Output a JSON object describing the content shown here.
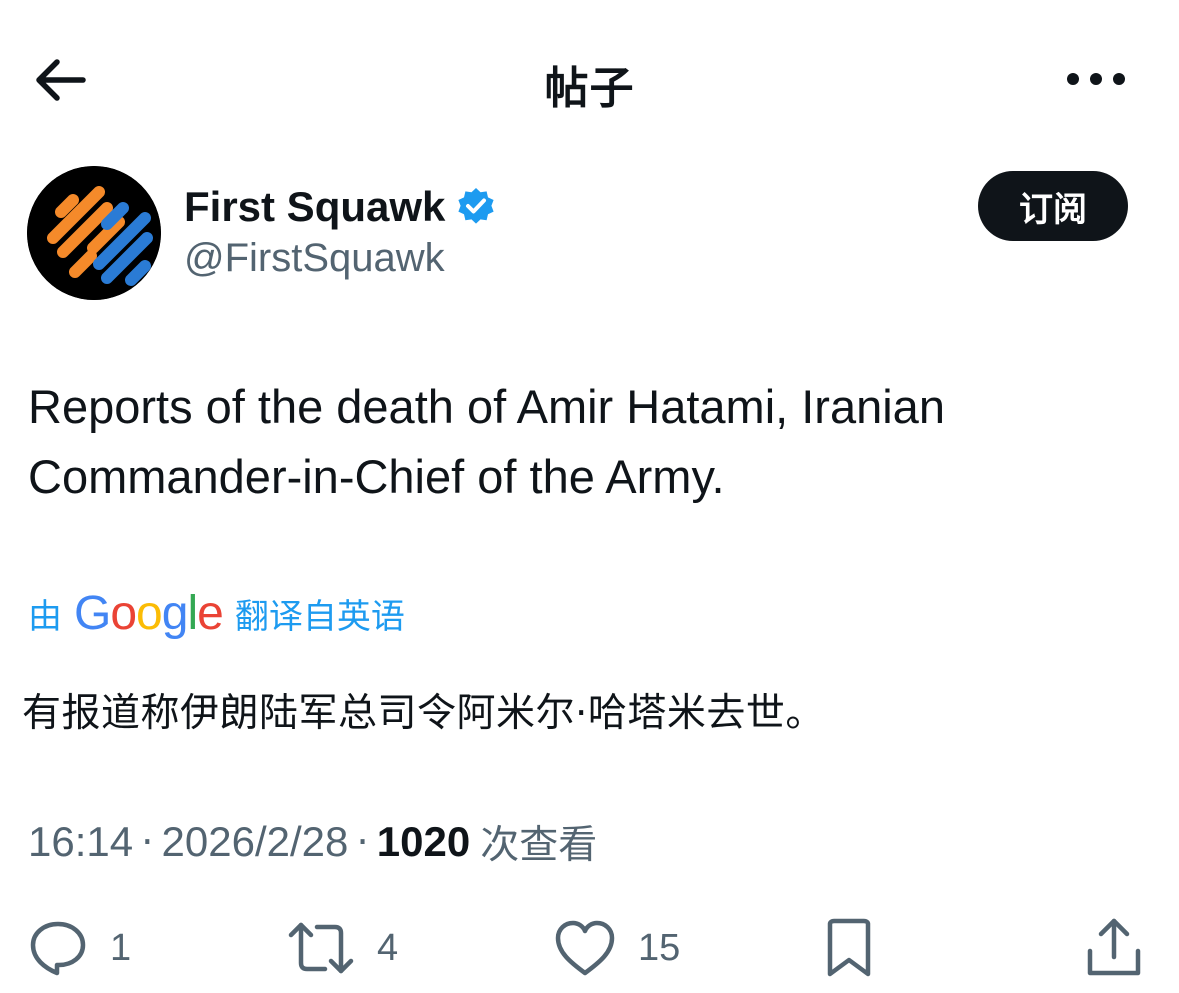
{
  "header": {
    "title": "帖子",
    "back_icon": "arrow-left-icon",
    "more_icon": "more-horizontal-icon"
  },
  "author": {
    "display_name": "First Squawk",
    "handle": "@FirstSquawk",
    "verified": true,
    "verified_color": "#1d9bf0",
    "avatar_colors": [
      "#f58a2a",
      "#2a7bd5",
      "#000000"
    ]
  },
  "subscribe_button": {
    "label": "订阅"
  },
  "tweet": {
    "text": "Reports of the death of Amir Hatami, Iranian Commander-in-Chief of the Army."
  },
  "translation": {
    "prefix": "由",
    "provider": "Google",
    "suffix": "翻译自英语",
    "text": "有报道称伊朗陆军总司令阿米尔·哈塔米去世。"
  },
  "meta": {
    "time": "16:14",
    "date": "2026/2/28",
    "separator": "·",
    "views": "1020",
    "views_label": "次查看"
  },
  "actions": {
    "reply_count": "1",
    "retweet_count": "4",
    "like_count": "15",
    "bookmark_icon": "bookmark-icon",
    "share_icon": "share-icon"
  },
  "colors": {
    "text_primary": "#0f1419",
    "text_secondary": "#536471",
    "accent": "#1d9bf0"
  }
}
